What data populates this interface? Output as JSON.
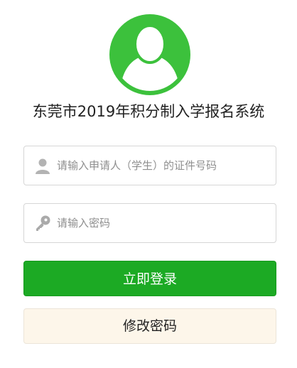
{
  "header": {
    "title": "东莞市2019年积分制入学报名系统"
  },
  "form": {
    "id_placeholder": "请输入申请人（学生）的证件号码",
    "password_placeholder": "请输入密码",
    "login_label": "立即登录",
    "change_password_label": "修改密码"
  },
  "colors": {
    "avatar_green": "#3cc13c",
    "login_green": "#1caa24",
    "change_bg": "#fdf6ea"
  },
  "icons": {
    "avatar": "user-avatar-icon",
    "id_field": "user-icon",
    "password_field": "key-icon"
  }
}
